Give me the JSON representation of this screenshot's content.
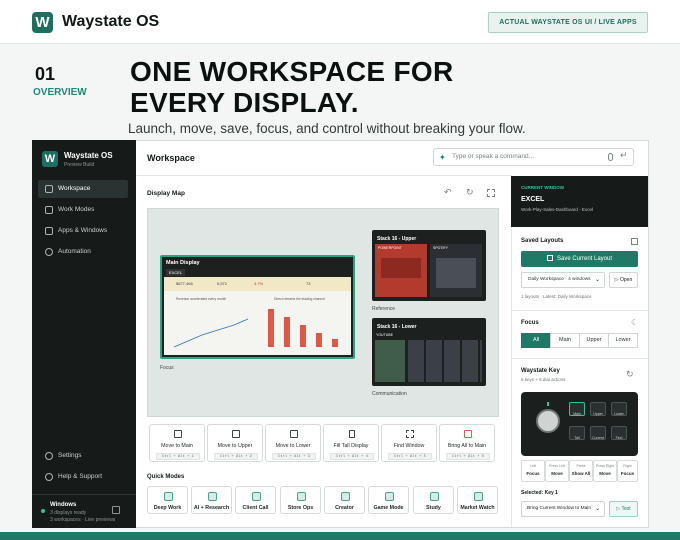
{
  "header": {
    "logo_letter": "W",
    "brand": "Waystate OS",
    "badge": "ACTUAL WAYSTATE OS UI / LIVE APPS"
  },
  "hero": {
    "number": "01",
    "section": "OVERVIEW",
    "headline": "ONE WORKSPACE FOR EVERY DISPLAY.",
    "subtitle": "Launch, move, save, focus, and control without breaking your flow."
  },
  "sidebar": {
    "logo_letter": "W",
    "title": "Waystate OS",
    "subtitle": "Preview Build",
    "items": [
      {
        "label": "Workspace",
        "icon": "window-icon",
        "active": true
      },
      {
        "label": "Work Modes",
        "icon": "grid-icon"
      },
      {
        "label": "Apps & Windows",
        "icon": "apps-icon"
      },
      {
        "label": "Automation",
        "icon": "link-icon"
      }
    ],
    "bottom_items": [
      {
        "label": "Settings",
        "icon": "gear-icon"
      },
      {
        "label": "Help & Support",
        "icon": "help-icon"
      }
    ],
    "footer": {
      "title": "Windows",
      "line1": "3 displays ready",
      "line2": "3 workspaces · Live previews"
    }
  },
  "main": {
    "title": "Workspace",
    "command_placeholder": "Type or speak a command...",
    "display_map": "Display Map",
    "monitors": {
      "main": {
        "title": "Main Display",
        "app": "EXCEL",
        "label": "Focus",
        "chart_title": "Revenue accelerated every month",
        "chart_title2": "Direct remains the leading channel",
        "stats": [
          "$877,466",
          "6,572",
          "4.7%",
          "73"
        ]
      },
      "upper": {
        "title": "Stack 16 - Upper",
        "app1": "POWERPOINT",
        "app2": "SPOTIFY",
        "label": "Reference"
      },
      "lower": {
        "title": "Stack 16 - Lower",
        "app": "YOUTUBE",
        "label": "Communication"
      }
    },
    "actions": [
      {
        "label": "Move to Main",
        "key": "Ctrl + Alt + 1",
        "icon": "monitor-icon"
      },
      {
        "label": "Move to Upper",
        "key": "Ctrl + Alt + 2",
        "icon": "upper-icon"
      },
      {
        "label": "Move to Lower",
        "key": "Ctrl + Alt + 3",
        "icon": "lower-icon"
      },
      {
        "label": "Fill Tall Display",
        "key": "Ctrl + Alt + 4",
        "icon": "phone-icon"
      },
      {
        "label": "Find Window",
        "key": "Ctrl + Alt + 5",
        "icon": "target-icon"
      },
      {
        "label": "Bring All to Main",
        "key": "Ctrl + Alt + 0",
        "icon": "stack-icon"
      }
    ],
    "quick_modes_label": "Quick Modes",
    "modes": [
      {
        "label": "Deep Work",
        "icon": "focus-icon"
      },
      {
        "label": "AI + Research",
        "icon": "bot-icon"
      },
      {
        "label": "Client Call",
        "icon": "video-icon"
      },
      {
        "label": "Store Ops",
        "icon": "store-icon"
      },
      {
        "label": "Creator",
        "icon": "camera-icon"
      },
      {
        "label": "Game Mode",
        "icon": "gamepad-icon"
      },
      {
        "label": "Study",
        "icon": "book-icon"
      },
      {
        "label": "Market Watch",
        "icon": "chart-icon"
      }
    ]
  },
  "right": {
    "current_label": "CURRENT WINDOW",
    "current_app": "EXCEL",
    "current_file": "Work-Play-Sales-Dashboard - Excel",
    "saved_title": "Saved Layouts",
    "save_btn": "Save Current Layout",
    "layout_select": "Daily Workspace · 4 windows",
    "open_btn": "Open",
    "layout_meta": "1 layouts · Latest: Daily Workspace",
    "focus_title": "Focus",
    "focus_tabs": [
      "All",
      "Main",
      "Upper",
      "Lower"
    ],
    "key_title": "Waystate Key",
    "key_sub": "6 keys + 5 dial actions",
    "keys": [
      "Main",
      "Upper",
      "Lower",
      "Tall",
      "Current",
      "Find"
    ],
    "dials": [
      {
        "label": "Left",
        "value": "Focus"
      },
      {
        "label": "Press Left",
        "value": "Move"
      },
      {
        "label": "Press",
        "value": "Show All"
      },
      {
        "label": "Press Right",
        "value": "Move"
      },
      {
        "label": "Right",
        "value": "Focus"
      }
    ],
    "selected": "Selected: Key 1",
    "action_select": "Bring Current Window to Main",
    "test_btn": "Test"
  }
}
